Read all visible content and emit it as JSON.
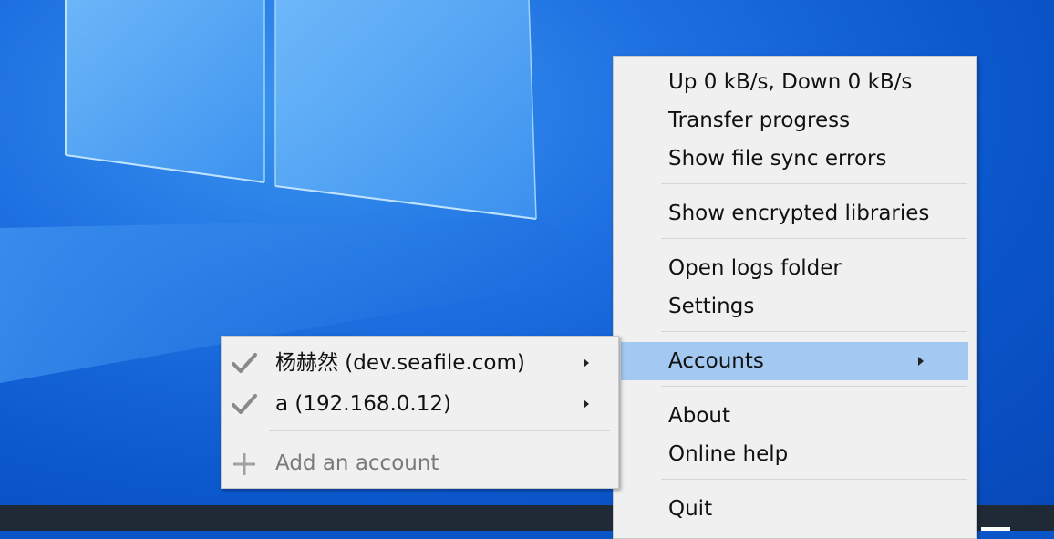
{
  "tray_menu": {
    "items": [
      {
        "label": "Up 0 kB/s, Down 0 kB/s"
      },
      {
        "label": "Transfer progress"
      },
      {
        "label": "Show file sync errors"
      },
      {
        "label": "Show encrypted libraries"
      },
      {
        "label": "Open logs folder"
      },
      {
        "label": "Settings"
      },
      {
        "label": "Accounts",
        "highlighted": true,
        "has_submenu": true
      },
      {
        "label": "About"
      },
      {
        "label": "Online help"
      },
      {
        "label": "Quit"
      }
    ]
  },
  "accounts_submenu": {
    "accounts": [
      {
        "label": "杨赫然 (dev.seafile.com)",
        "checked": true,
        "has_submenu": true
      },
      {
        "label": "a (192.168.0.12)",
        "checked": true,
        "has_submenu": true
      }
    ],
    "add_account_label": "Add an account"
  },
  "icons": [
    "check-icon",
    "plus-icon",
    "submenu-arrow-icon"
  ],
  "colors": {
    "highlight": "#a3c9f2",
    "menu_bg": "#f0f0f0",
    "taskbar": "#1f2a36"
  }
}
